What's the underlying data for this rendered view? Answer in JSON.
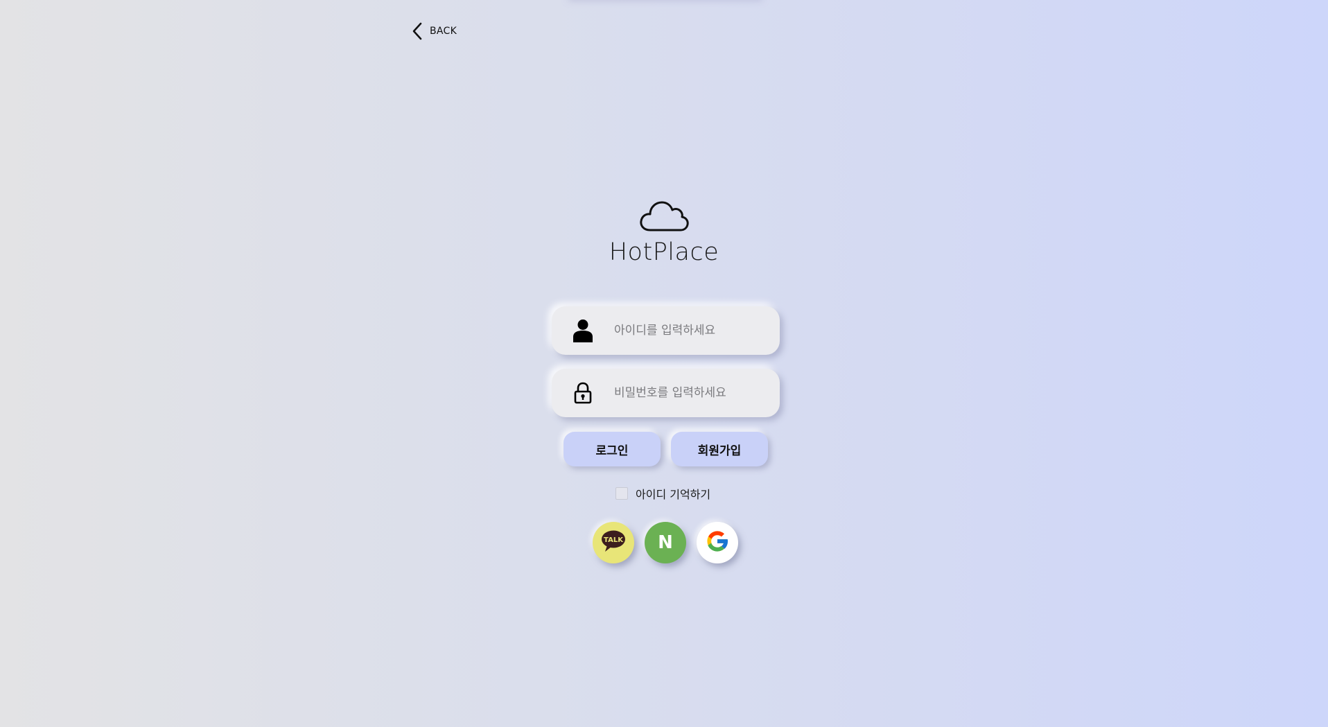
{
  "nav": {
    "back_label": "BACK"
  },
  "brand": {
    "title": "HotPlace",
    "icon": "cloud-icon"
  },
  "login_form": {
    "id_field": {
      "placeholder": "아이디를 입력하세요",
      "value": "",
      "icon": "user-icon"
    },
    "password_field": {
      "placeholder": "비밀번호를 입력하세요",
      "value": "",
      "icon": "lock-icon"
    },
    "login_label": "로그인",
    "signup_label": "회원가입",
    "remember_label": "아이디 기억하기",
    "remember_checked": false
  },
  "social_login": {
    "kakao": {
      "icon": "kakao-talk-icon",
      "text": "TALK",
      "color": "#e8e578"
    },
    "naver": {
      "icon": "naver-icon",
      "text": "N",
      "color": "#6bb153"
    },
    "google": {
      "icon": "google-icon",
      "color": "#ffffff"
    }
  },
  "colors": {
    "button": "#c9d1f8",
    "field": "#ececef"
  }
}
